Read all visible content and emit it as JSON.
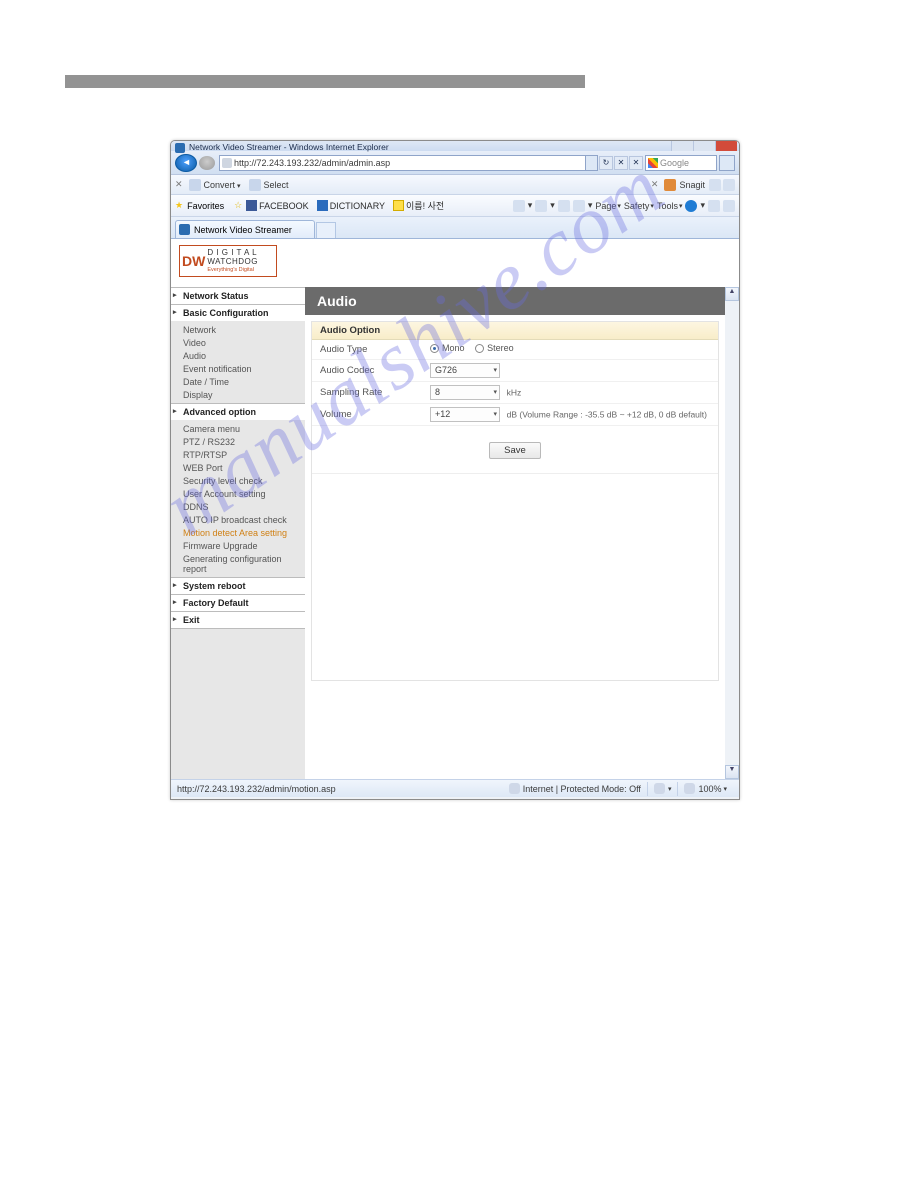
{
  "window": {
    "title": "Network Video Streamer - Windows Internet Explorer"
  },
  "address_bar": {
    "url": "http://72.243.193.232/admin/admin.asp",
    "search_placeholder": "Google",
    "refresh_icon": "↻",
    "stop_icon": "✕"
  },
  "convert_bar": {
    "convert_label": "Convert",
    "select_label": "Select",
    "snagit_label": "Snagit"
  },
  "favorites": {
    "label": "Favorites",
    "links": [
      "FACEBOOK",
      "DICTIONARY",
      "이름! 사전"
    ],
    "menu": {
      "page": "Page",
      "safety": "Safety",
      "tools": "Tools"
    }
  },
  "tab": {
    "title": "Network Video Streamer"
  },
  "logo": {
    "brand": "DW",
    "line1": "D I G I T A L",
    "line2": "WATCHDOG",
    "sub": "Everything's Digital"
  },
  "sidebar": {
    "sections": [
      {
        "title": "Network Status",
        "items": []
      },
      {
        "title": "Basic Configuration",
        "items": [
          "Network",
          "Video",
          "Audio",
          "Event notification",
          "Date / Time",
          "Display"
        ]
      },
      {
        "title": "Advanced option",
        "items": [
          "Camera menu",
          "PTZ / RS232",
          "RTP/RTSP",
          "WEB Port",
          "Security level check",
          "User Account setting",
          "DDNS",
          "AUTO IP broadcast check",
          "Motion detect Area setting",
          "Firmware Upgrade",
          "Generating configuration report"
        ]
      },
      {
        "title": "System reboot",
        "items": []
      },
      {
        "title": "Factory Default",
        "items": []
      },
      {
        "title": "Exit",
        "items": []
      }
    ]
  },
  "main": {
    "title": "Audio",
    "panel_heading": "Audio Option",
    "fields": {
      "audio_type": {
        "label": "Audio Type",
        "options": [
          "Mono",
          "Stereo"
        ],
        "selected": "Mono"
      },
      "audio_codec": {
        "label": "Audio Codec",
        "value": "G726"
      },
      "sampling_rate": {
        "label": "Sampling Rate",
        "value": "8",
        "unit": "kHz"
      },
      "volume": {
        "label": "Volume",
        "value": "+12",
        "hint": "dB (Volume Range : -35.5 dB ~ +12 dB, 0 dB default)"
      }
    },
    "save_label": "Save"
  },
  "status_bar": {
    "link_hover": "http://72.243.193.232/admin/motion.asp",
    "zone": "Internet | Protected Mode: Off",
    "zoom": "100%"
  },
  "watermark": "manualshive.com"
}
